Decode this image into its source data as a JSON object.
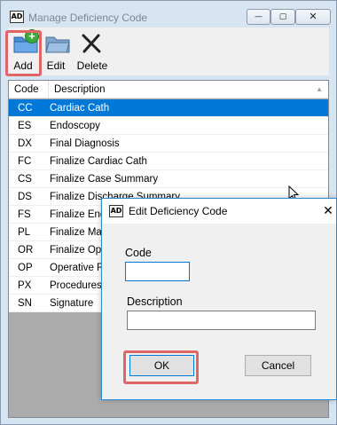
{
  "window": {
    "title": "Manage Deficiency Code",
    "app_icon_text": "AD",
    "minimize_glyph": "—",
    "maximize_glyph": "▢",
    "close_glyph": "✕"
  },
  "toolbar": {
    "add_label": "Add",
    "edit_label": "Edit",
    "delete_label": "Delete",
    "plus_glyph": "+"
  },
  "grid": {
    "headers": {
      "code": "Code",
      "description": "Description"
    },
    "sort_glyph": "▲",
    "rows": [
      {
        "code": "CC",
        "description": "Cardiac Cath",
        "selected": true
      },
      {
        "code": "ES",
        "description": "Endoscopy"
      },
      {
        "code": "DX",
        "description": "Final Diagnosis"
      },
      {
        "code": "FC",
        "description": "Finalize Cardiac Cath"
      },
      {
        "code": "CS",
        "description": "Finalize Case Summary"
      },
      {
        "code": "DS",
        "description": "Finalize Discharge Summary"
      },
      {
        "code": "FS",
        "description": "Finalize Endo"
      },
      {
        "code": "PL",
        "description": "Finalize Mast"
      },
      {
        "code": "OR",
        "description": "Finalize Oper"
      },
      {
        "code": "OP",
        "description": "Operative Re"
      },
      {
        "code": "PX",
        "description": "Procedures"
      },
      {
        "code": "SN",
        "description": "Signature"
      }
    ]
  },
  "dialog": {
    "title": "Edit Deficiency Code",
    "app_icon_text": "AD",
    "close_glyph": "✕",
    "code_label": "Code",
    "code_value": "",
    "description_label": "Description",
    "description_value": "",
    "ok_label": "OK",
    "cancel_label": "Cancel"
  },
  "colors": {
    "selection": "#0078d7",
    "highlight_box": "#e06565",
    "window_bg": "#d7e4f2",
    "grid_empty": "#ababab"
  }
}
